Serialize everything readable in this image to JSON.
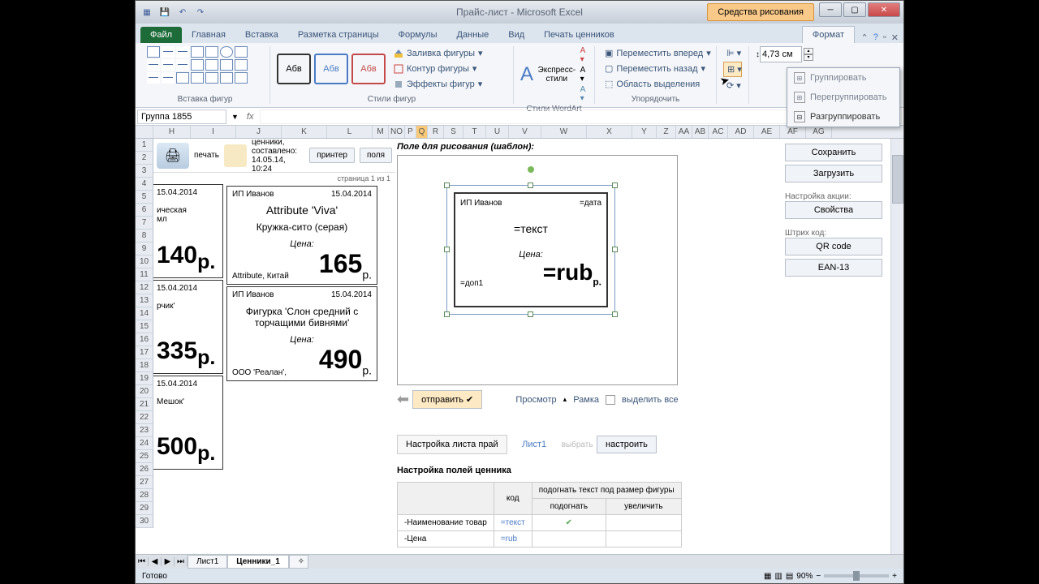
{
  "titlebar": {
    "title": "Прайс-лист - Microsoft Excel",
    "context": "Средства рисования"
  },
  "tabs": {
    "file": "Файл",
    "items": [
      "Главная",
      "Вставка",
      "Разметка страницы",
      "Формулы",
      "Данные",
      "Вид",
      "Печать ценников"
    ],
    "format": "Формат"
  },
  "ribbon": {
    "insert_shapes": "Вставка фигур",
    "shape_styles": "Стили фигур",
    "abc": "Абв",
    "fill": "Заливка фигуры",
    "outline": "Контур фигуры",
    "effects": "Эффекты фигур",
    "express": "Экспресс-стили",
    "wa_styles": "Стили WordArt",
    "bring_fwd": "Переместить вперед",
    "send_back": "Переместить назад",
    "selection": "Область выделения",
    "arrange": "Упорядочить",
    "size_val": "4,73 см"
  },
  "group_menu": {
    "group": "Группировать",
    "regroup": "Перегруппировать",
    "ungroup": "Разгруппировать"
  },
  "namebox": "Группа 1855",
  "columns": [
    "H",
    "I",
    "J",
    "K",
    "L",
    "M",
    "NO",
    "P",
    "Q",
    "R",
    "S",
    "T",
    "U",
    "V",
    "W",
    "X",
    "Y",
    "Z",
    "AA",
    "AB",
    "AC",
    "AD",
    "AE",
    "AF",
    "AG"
  ],
  "top": {
    "label": "ценники, составлено:",
    "date": "14.05.14, 10:24",
    "print": "печать",
    "printer": "принтер",
    "fields": "поля",
    "page": "страница 1 из 1"
  },
  "tags": {
    "vendor": "ИП Иванов",
    "date": "15.04.2014",
    "t1_title": "Attribute 'Viva'",
    "t1_sub": "Кружка-сито (серая)",
    "t1_sup": "Attribute, Китай",
    "t1_price": "165",
    "t2_title": "Фигурка 'Слон средний с торчащими бивнями'",
    "t2_sup": "ООО 'Реалан',",
    "t2_price": "490",
    "price_label": "Цена:",
    "rub": "р.",
    "frag1": "ическая",
    "frag1b": "мл",
    "frag2": "рчик'",
    "frag3": "Мешок'",
    "p140": "140",
    "p335": "335",
    "p500": "500"
  },
  "template": {
    "label": "Поле для рисования (шаблон):",
    "vendor": "ИП Иванов",
    "date": "=дата",
    "text": "=текст",
    "price_lbl": "Цена:",
    "dop": "=доп1",
    "rub": "=rub",
    "r": "р."
  },
  "buttons": {
    "send": "отправить",
    "preview": "Просмотр",
    "frame": "Рамка",
    "select_all": "выделить все",
    "save": "Сохранить",
    "load": "Загрузить",
    "promo": "Настройка акции:",
    "props": "Свойства",
    "barcode": "Штрих код:",
    "qr": "QR code",
    "ean": "EAN-13"
  },
  "config": {
    "sheet_label": "Настройка листа прай",
    "sheet": "Лист1",
    "select": "выбрать",
    "setup": "настроить",
    "fields_label": "Настройка полей ценника",
    "col1": "код",
    "col2": "подогнать текст под размер фигуры",
    "fit": "подогнать",
    "enlarge": "увеличить",
    "r1": "-Наименование товар",
    "r1v": "=текст",
    "r2": "-Цена",
    "r2v": "=rub"
  },
  "sheets": {
    "s1": "Лист1",
    "s2": "Ценники_1"
  },
  "status": {
    "ready": "Готово",
    "zoom": "90%"
  }
}
